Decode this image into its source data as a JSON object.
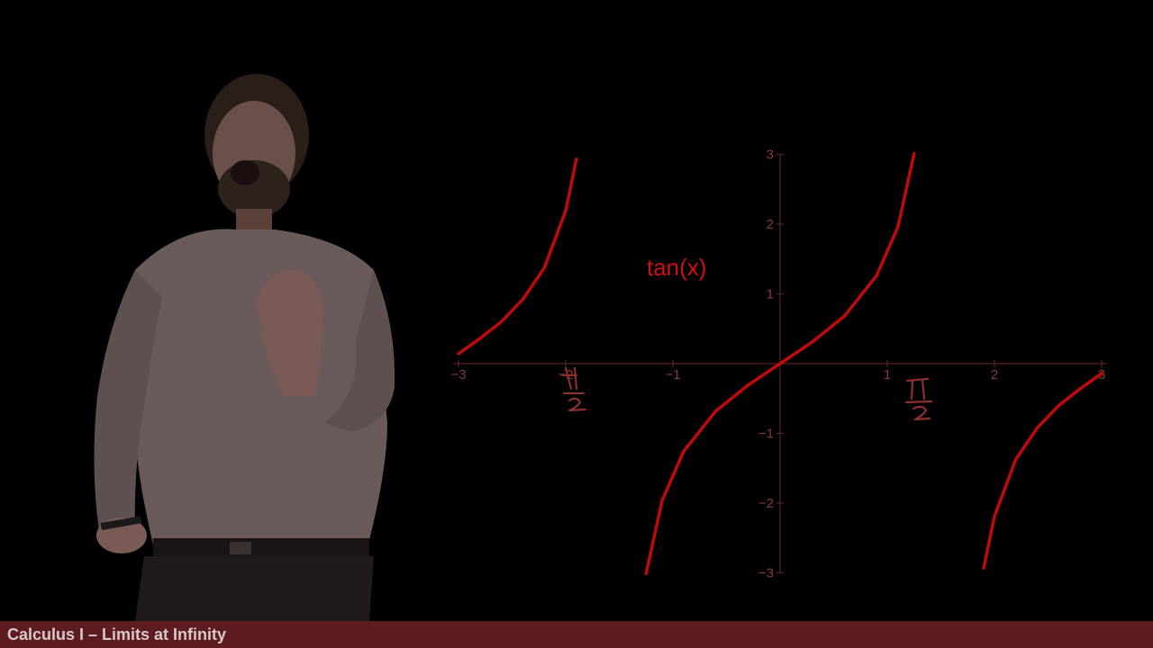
{
  "footer": {
    "title": "Calculus I – Limits at Infinity"
  },
  "colors": {
    "curve": "#c00a0a",
    "axis": "#5a2222",
    "footer_bg": "#5e1c20"
  },
  "annotations": {
    "pi_over_2": "π/2",
    "neg_pi_over_2": "−π/2"
  },
  "chart_data": {
    "type": "line",
    "title": "",
    "function_label": "tan(x)",
    "xlabel": "",
    "ylabel": "",
    "xlim": [
      -3.05,
      3.05
    ],
    "ylim": [
      -3,
      3
    ],
    "x_ticks": [
      -3,
      -2,
      -1,
      1,
      2,
      3
    ],
    "x_tick_labels": [
      "−3",
      "−2",
      "−1",
      "1",
      "2",
      "3"
    ],
    "y_ticks": [
      -3,
      -2,
      -1,
      1,
      2,
      3
    ],
    "y_tick_labels": [
      "−3",
      "−2",
      "−1",
      "1",
      "2",
      "3"
    ],
    "grid": false,
    "series": [
      {
        "name": "",
        "x": [
          -3.0,
          -2.8,
          -2.6,
          -2.4,
          -2.2,
          -2.0,
          -1.9
        ],
        "y": [
          0.14,
          0.36,
          0.6,
          0.92,
          1.37,
          2.19,
          2.93
        ]
      },
      {
        "name": "",
        "x": [
          -1.25,
          -1.1,
          -0.9,
          -0.6,
          -0.3,
          0.0,
          0.3,
          0.6,
          0.9,
          1.1,
          1.25
        ],
        "y": [
          -3.01,
          -1.96,
          -1.26,
          -0.68,
          -0.31,
          0.0,
          0.31,
          0.68,
          1.26,
          1.96,
          3.01
        ]
      },
      {
        "name": "",
        "x": [
          1.9,
          2.0,
          2.2,
          2.4,
          2.6,
          2.8,
          3.0
        ],
        "y": [
          -2.93,
          -2.19,
          -1.37,
          -0.92,
          -0.6,
          -0.36,
          -0.14
        ]
      }
    ]
  }
}
